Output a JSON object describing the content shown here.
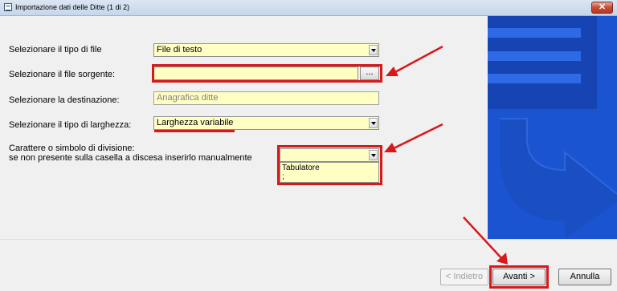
{
  "window": {
    "title": "Importazione dati delle Ditte (1 di 2)",
    "close_glyph": "✕"
  },
  "form": {
    "file_type": {
      "label": "Selezionare il tipo di file",
      "value": "File di testo"
    },
    "source_file": {
      "label": "Selezionare il file sorgente:",
      "value": "",
      "browse_label": "..."
    },
    "destination": {
      "label": "Selezionare la destinazione:",
      "value": "Anagrafica ditte"
    },
    "width_type": {
      "label": "Selezionare il tipo di larghezza:",
      "value": "Larghezza variabile"
    },
    "separator": {
      "label_line1": "Carattere o simbolo di divisione:",
      "label_line2": "se non presente sulla casella a discesa inserirlo manualmente",
      "value": "",
      "options": [
        "Tabulatore",
        ";"
      ]
    }
  },
  "buttons": {
    "back": "< Indietro",
    "next": "Avanti >",
    "cancel": "Annulla"
  },
  "colors": {
    "field_bg": "#ffffc4",
    "annotation_red": "#d7191c",
    "graphic_blue": "#1b54d0"
  },
  "icons": [
    "app-icon",
    "close-icon",
    "dropdown-arrow-icon",
    "decorative-arrow-graphic"
  ]
}
